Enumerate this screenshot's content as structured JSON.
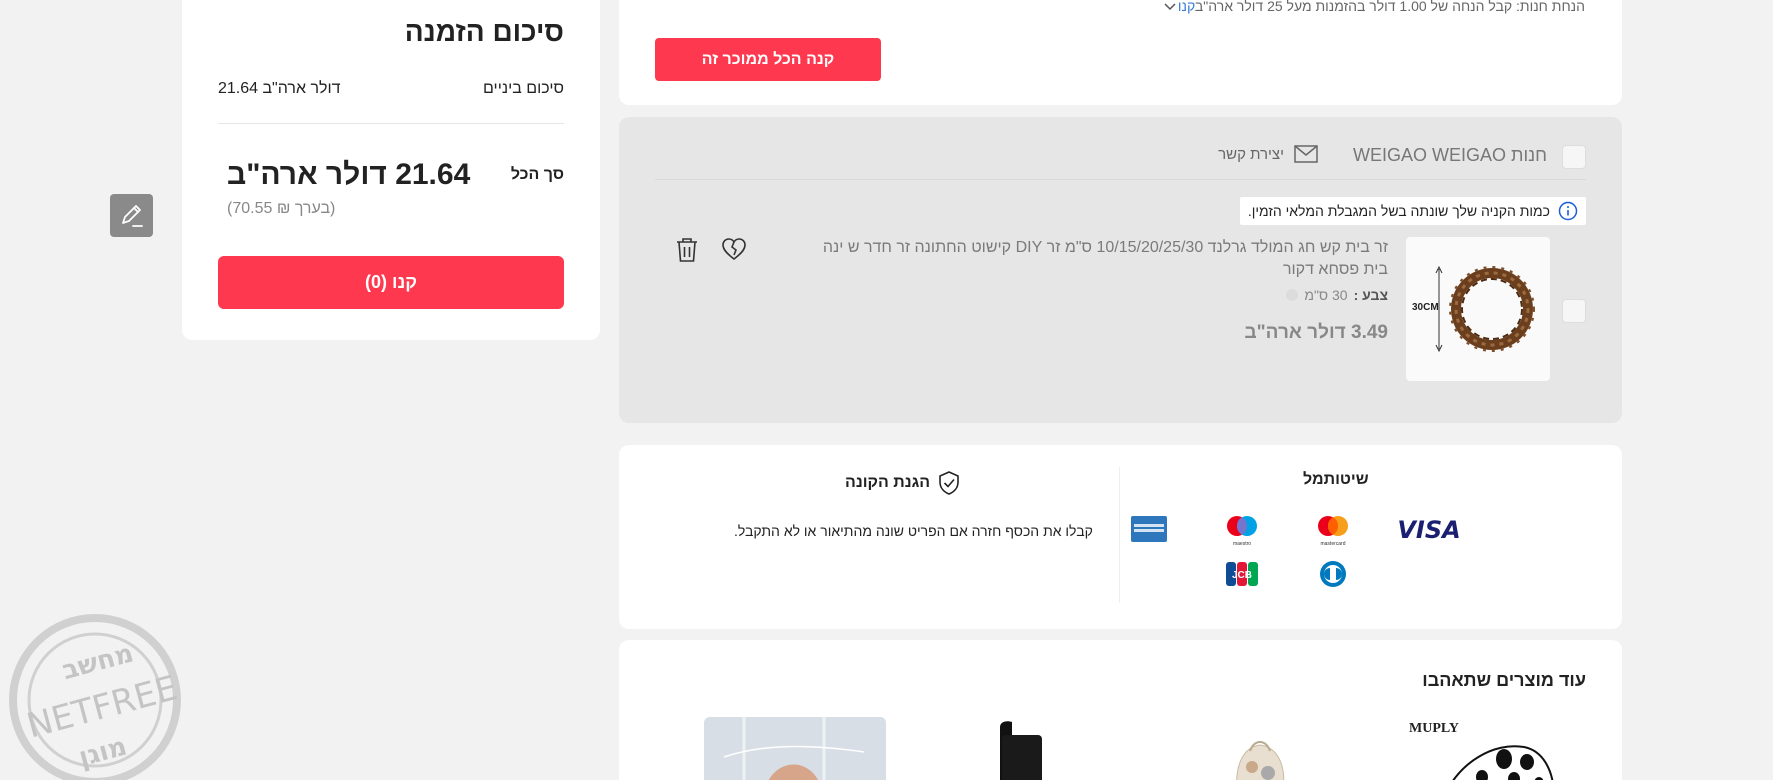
{
  "summary": {
    "title": "סיכום הזמנה",
    "subtotal_label": "סיכום ביניים",
    "subtotal_value": "21.64 דולר ארה\"ב",
    "total_label": "סך הכל",
    "total_value": "21.64 דולר ארה\"ב",
    "total_approx": "(בערך ₪ 70.55)",
    "buy_label": "קנו (0)"
  },
  "store_top": {
    "notice_prefix": "הנחת חנות:",
    "notice_text": "קבל הנחה של 1.00 דולר בהזמנות מעל 25 דולר ארה\"ב",
    "notice_link": "קנו",
    "buy_all_label": "קנה הכל ממוכר זה"
  },
  "store": {
    "name": "חנות WEIGAO WEIGAO",
    "contact_label": "יצירת קשר",
    "warning": "כמות הקניה שלך שונתה בשל המגבלת המלאי הזמין.",
    "item": {
      "title": "זר בית קש חג המולד גרלנד 10/15/20/25/30 ס\"מ זר DIY קישוט החתונה זר חדר ש ינה בית פסחא דקור",
      "color_label": "צבע :",
      "color_value": "30 ס\"מ",
      "thumb_label": "30CM",
      "price": "3.49 דולר ארה\"ב"
    }
  },
  "payments": {
    "title": "שיטותמל",
    "methods": [
      "visa",
      "mastercard",
      "maestro",
      "amex",
      "diners",
      "jcb"
    ],
    "visa_text": "VISA",
    "mastercard_text": "mastercard",
    "maestro_text": "maestro",
    "jcb_text": "JCB"
  },
  "protection": {
    "title": "הגנת הקונה",
    "text": "קבלו את הכסף חזרה אם הפריט שונה מהתיאור או לא התקבל."
  },
  "recommendations": {
    "title": "עוד מוצרים שתאהבו",
    "first_brand": "MUPLY"
  },
  "watermark": {
    "top": "מחשב",
    "middle": "NETFREE",
    "bottom": "מוגן"
  },
  "colors": {
    "accent": "#fd384f",
    "link": "#3a7bd5",
    "page_bg": "#f2f2f2"
  }
}
